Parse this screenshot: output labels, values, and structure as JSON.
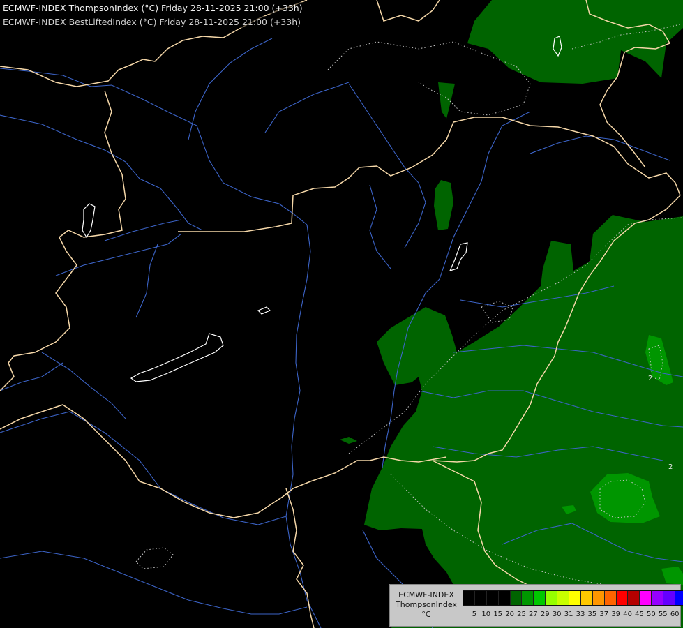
{
  "header": {
    "line1": "ECMWF-INDEX ThompsonIndex (°C) Friday 28-11-2025 21:00 (+33h)",
    "line2": "ECMWF-INDEX BestLiftedIndex (°C) Friday 28-11-2025 21:00 (+33h)"
  },
  "legend": {
    "model": "ECMWF-INDEX",
    "parameter": "ThompsonIndex",
    "unit": "°C",
    "levels": [
      "5",
      "10",
      "15",
      "20",
      "25",
      "27",
      "29",
      "30",
      "31",
      "33",
      "35",
      "37",
      "39",
      "40",
      "45",
      "50",
      "55",
      "60"
    ],
    "colors": [
      "#000000",
      "#000000",
      "#000000",
      "#000000",
      "#006400",
      "#009600",
      "#00c800",
      "#96ff00",
      "#c8ff00",
      "#ffff00",
      "#ffc800",
      "#ff9600",
      "#ff6400",
      "#ff0000",
      "#b40000",
      "#ff00ff",
      "#9600ff",
      "#6400ff",
      "#0000ff"
    ]
  },
  "contour_labels": [
    "2",
    "2"
  ],
  "colors": {
    "background": "#000000",
    "border": "#f5d7a8",
    "river": "#3c64c8",
    "lake_outline": "#ffffff",
    "contour": "#c8c8c8",
    "fill_dark_green": "#006400",
    "fill_green": "#009600"
  }
}
